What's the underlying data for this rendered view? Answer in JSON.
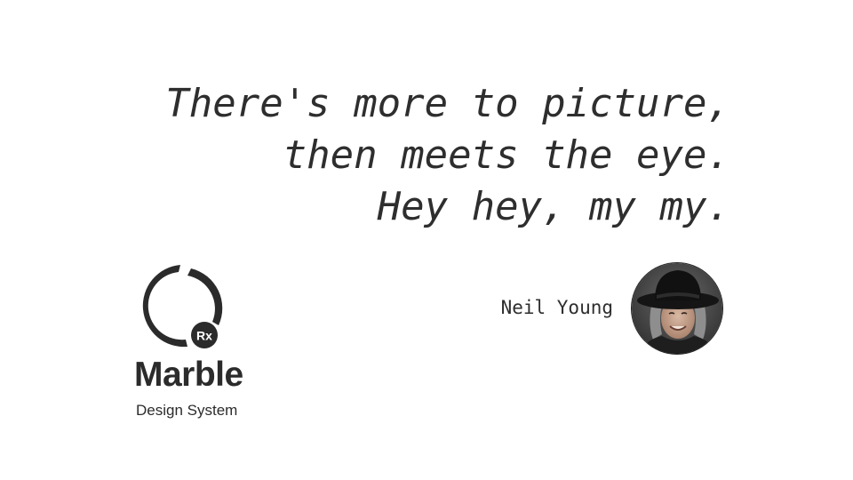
{
  "quote": {
    "lines": [
      "There's more to picture,",
      "then meets the eye.",
      "Hey hey, my my."
    ],
    "author": "Neil Young"
  },
  "brand": {
    "badge": "Rx",
    "name": "Marble",
    "tagline": "Design System"
  },
  "colors": {
    "text": "#2e2e2e",
    "logo": "#2b2b2b",
    "background": "#ffffff"
  }
}
